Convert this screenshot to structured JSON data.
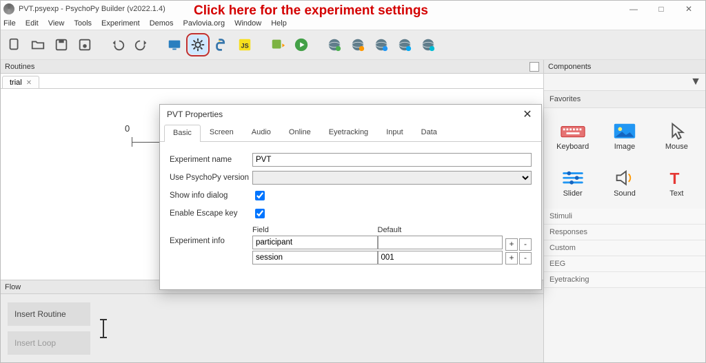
{
  "window": {
    "title": "PVT.psyexp - PsychoPy Builder (v2022.1.4)",
    "annotation": "Click here for the experiment settings"
  },
  "menus": [
    "File",
    "Edit",
    "View",
    "Tools",
    "Experiment",
    "Demos",
    "Pavlovia.org",
    "Window",
    "Help"
  ],
  "panels": {
    "routines": "Routines",
    "flow": "Flow",
    "components": "Components"
  },
  "routine_tab": "trial",
  "timeline_zero": "0",
  "flow_buttons": {
    "insert_routine": "Insert Routine",
    "insert_loop": "Insert Loop"
  },
  "components": {
    "favorites_label": "Favorites",
    "items": [
      {
        "label": "Keyboard"
      },
      {
        "label": "Image"
      },
      {
        "label": "Mouse"
      },
      {
        "label": "Slider"
      },
      {
        "label": "Sound"
      },
      {
        "label": "Text"
      }
    ],
    "categories": [
      "Stimuli",
      "Responses",
      "Custom",
      "EEG",
      "Eyetracking"
    ]
  },
  "dialog": {
    "title": "PVT Properties",
    "tabs": [
      "Basic",
      "Screen",
      "Audio",
      "Online",
      "Eyetracking",
      "Input",
      "Data"
    ],
    "active_tab": "Basic",
    "fields": {
      "exp_name_label": "Experiment name",
      "exp_name_value": "PVT",
      "psy_ver_label": "Use PsychoPy version",
      "psy_ver_value": "",
      "show_info_label": "Show info dialog",
      "show_info_checked": true,
      "escape_label": "Enable Escape key",
      "escape_checked": true,
      "exp_info_label": "Experiment info",
      "field_hdr": "Field",
      "default_hdr": "Default",
      "rows": [
        {
          "field": "participant",
          "def": ""
        },
        {
          "field": "session",
          "def": "001"
        }
      ]
    }
  }
}
